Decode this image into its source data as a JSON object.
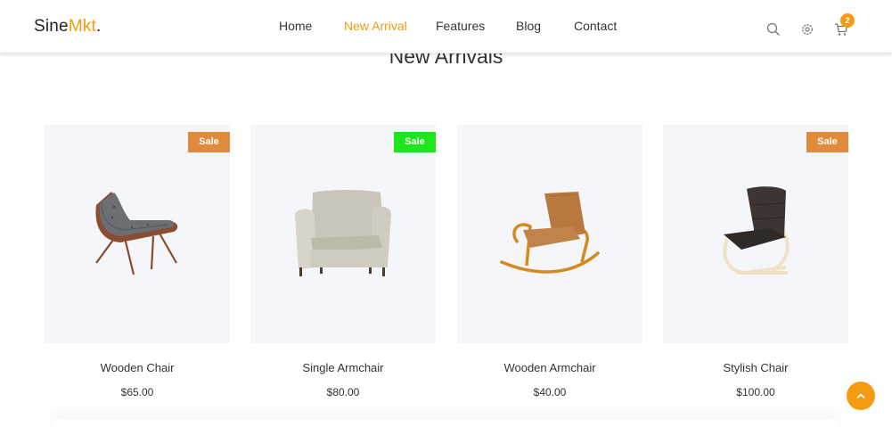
{
  "brand": {
    "name_main": "Sine",
    "name_accent": "Mkt",
    "name_dot": "."
  },
  "nav": {
    "items": [
      {
        "label": "Home",
        "active": false
      },
      {
        "label": "New Arrival",
        "active": true
      },
      {
        "label": "Features",
        "active": false
      },
      {
        "label": "Blog",
        "active": false
      },
      {
        "label": "Contact",
        "active": false
      }
    ],
    "icons": [
      "search-icon",
      "gear-icon",
      "cart-icon"
    ],
    "cart_count": "2"
  },
  "section": {
    "title": "New Arrivals"
  },
  "products": [
    {
      "name": "Wooden Chair",
      "price": "$65.00",
      "badge": "Sale",
      "badge_color": "#e08a3c"
    },
    {
      "name": "Single Armchair",
      "price": "$80.00",
      "badge": "Sale",
      "badge_color": "#1de61d"
    },
    {
      "name": "Wooden Armchair",
      "price": "$40.00",
      "badge": "",
      "badge_color": ""
    },
    {
      "name": "Stylish Chair",
      "price": "$100.00",
      "badge": "Sale",
      "badge_color": "#e08a3c"
    }
  ],
  "colors": {
    "accent": "#f39c12",
    "card_bg": "#f5f6fa"
  },
  "scroll_top_icon": "chevron-up-icon"
}
